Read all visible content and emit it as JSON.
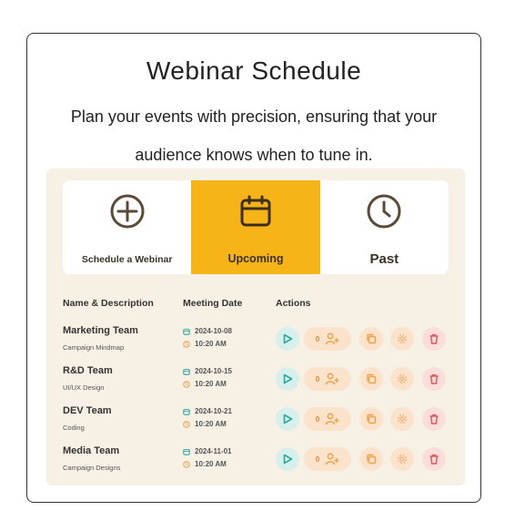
{
  "header": {
    "title": "Webinar Schedule",
    "subtitle": "Plan your events with precision, ensuring that your audience knows when to tune in."
  },
  "tabs": [
    {
      "label": "Schedule a Webinar",
      "icon": "plus-circle-icon",
      "active": false
    },
    {
      "label": "Upcoming",
      "icon": "calendar-icon",
      "active": true
    },
    {
      "label": "Past",
      "icon": "clock-icon",
      "active": false
    }
  ],
  "table": {
    "headers": [
      "Name & Description",
      "Meeting Date",
      "Actions"
    ],
    "rows": [
      {
        "name": "Marketing Team",
        "desc": "Campaign Mindmap",
        "date": "2024-10-08",
        "time": "10:20 AM",
        "count": "0"
      },
      {
        "name": "R&D Team",
        "desc": "UI/UX Design",
        "date": "2024-10-15",
        "time": "10:20 AM",
        "count": "0"
      },
      {
        "name": "DEV Team",
        "desc": "Coding",
        "date": "2024-10-21",
        "time": "10:20 AM",
        "count": "0"
      },
      {
        "name": "Media Team",
        "desc": "Campaign Designs",
        "date": "2024-11-01",
        "time": "10:20 AM",
        "count": "0"
      }
    ]
  },
  "colors": {
    "accent": "#f6b417",
    "panel": "#f7f1e5",
    "play": "#2aa89a",
    "action": "#f0a04b",
    "delete": "#e0585b"
  }
}
